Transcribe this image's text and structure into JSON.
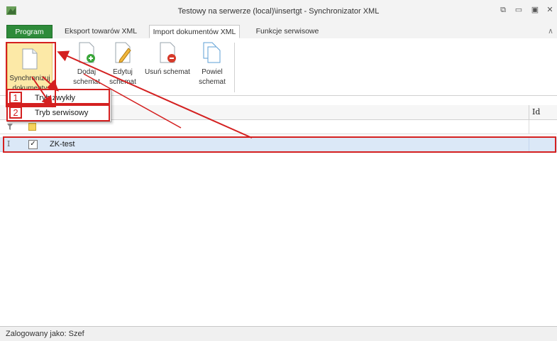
{
  "window": {
    "title": "Testowy na serwerze (local)\\insertgt - Synchronizator XML",
    "controls": [
      "restore-icon",
      "minimize-icon",
      "maximize-icon",
      "close-icon"
    ]
  },
  "tabs": [
    {
      "label": "Program",
      "active": false
    },
    {
      "label": "Eksport towarów XML",
      "active": false
    },
    {
      "label": "Import dokumentów XML",
      "active": true
    },
    {
      "label": "Funkcje serwisowe",
      "active": false
    }
  ],
  "ribbon": {
    "sync_label_1": "Synchronizuj",
    "sync_label_2": "dokumenty",
    "add_label_1": "Dodaj",
    "add_label_2": "schemat",
    "edit_label_1": "Edytuj",
    "edit_label_2": "schemat",
    "delete_label": "Usuń schemat",
    "dup_label_1": "Powiel",
    "dup_label_2": "schemat"
  },
  "menu": {
    "items": [
      {
        "num": "1",
        "label": "Tryb zwykły"
      },
      {
        "num": "2",
        "label": "Tryb serwisowy"
      }
    ]
  },
  "grid": {
    "id_header": "Id",
    "rows": [
      {
        "checked": "✓",
        "name": "ZK-test"
      }
    ]
  },
  "status": {
    "text": "Zalogowany jako: Szef"
  },
  "colors": {
    "accent_green": "#2e8b3a",
    "highlight_yellow": "#fce9a7",
    "annotation_red": "#d42020",
    "row_selected": "#dbe8f7"
  }
}
